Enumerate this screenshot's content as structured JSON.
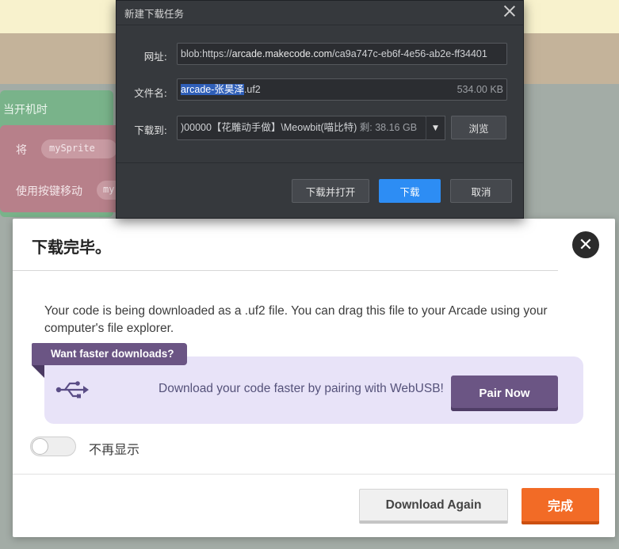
{
  "editor": {
    "event_block_label": "当开机时",
    "set_label": "将",
    "sprite_var": "mySprite",
    "move_label": "使用按键移动",
    "move_var": "my"
  },
  "download_dialog": {
    "title": "新建下载任务",
    "url_label": "网址:",
    "url_value_prefix": "blob:https://",
    "url_host": "arcade.makecode.com",
    "url_path": "/ca9a747c-eb6f-4e56-ab2e-ff34401",
    "filename_label": "文件名:",
    "filename_selected": "arcade-张昊泽",
    "filename_ext": ".uf2",
    "file_size": "534.00 KB",
    "saveto_label": "下载到:",
    "saveto_path": ")00000【花雕动手做】\\Meowbit(喵比特)",
    "free_space": "剩: 38.16 GB",
    "browse_button": "浏览",
    "download_open_button": "下载并打开",
    "download_button": "下载",
    "cancel_button": "取消",
    "colors": {
      "bg": "#36393d",
      "primary": "#2d8df4",
      "selection": "#2f5fb8"
    }
  },
  "modal": {
    "title": "下载完毕。",
    "description": "Your code is being downloaded as a .uf2 file. You can drag this file to your Arcade using your computer's file explorer.",
    "tag": "Want faster downloads?",
    "webusb_text": "Download your code faster by pairing with WebUSB!",
    "pair_button": "Pair Now",
    "dont_show_label": "不再显示",
    "dont_show_enabled": false,
    "download_again_button": "Download Again",
    "done_button": "完成",
    "icons": {
      "close": "close-circle-icon",
      "usb": "usb-icon"
    },
    "colors": {
      "accent": "#6b5584",
      "done": "#f26b26",
      "panel": "#e8e3f8"
    }
  }
}
